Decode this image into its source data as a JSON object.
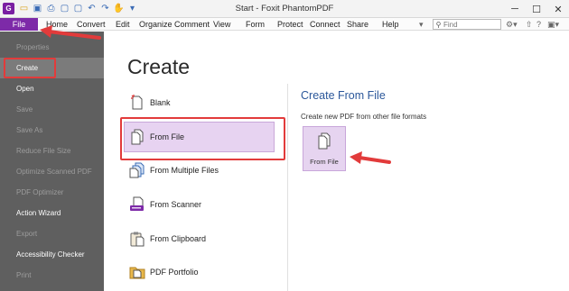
{
  "window": {
    "title": "Start - Foxit PhantomPDF"
  },
  "app_logo": "G",
  "quick_access": [
    {
      "icon": "open-folder-icon",
      "glyph": "▭",
      "tone": "yellow"
    },
    {
      "icon": "save-icon",
      "glyph": "▣",
      "tone": "blue"
    },
    {
      "icon": "print-icon",
      "glyph": "⎙",
      "tone": "blue"
    },
    {
      "icon": "page-icon",
      "glyph": "▢",
      "tone": "blue"
    },
    {
      "icon": "page-icon",
      "glyph": "▢",
      "tone": "blue"
    },
    {
      "icon": "undo-icon",
      "glyph": "↶",
      "tone": "blue"
    },
    {
      "icon": "redo-icon",
      "glyph": "↷",
      "tone": "blue"
    },
    {
      "icon": "hand-tool-icon",
      "glyph": "✋",
      "tone": "blue"
    },
    {
      "icon": "customize-icon",
      "glyph": "▾",
      "tone": "blue"
    }
  ],
  "menu": {
    "file": "File",
    "items": [
      "Home",
      "Convert",
      "Edit",
      "Organize",
      "Comment",
      "View",
      "Form",
      "Protect",
      "Connect",
      "Share",
      "Help"
    ]
  },
  "search": {
    "placeholder": "Find"
  },
  "window_controls": {
    "minimize": "─",
    "maximize": "☐",
    "close": "✕"
  },
  "sidebar": {
    "items": [
      {
        "label": "Properties",
        "state": "disabled"
      },
      {
        "label": "Create",
        "state": "selected"
      },
      {
        "label": "Open",
        "state": "enabled"
      },
      {
        "label": "Save",
        "state": "disabled"
      },
      {
        "label": "Save As",
        "state": "disabled"
      },
      {
        "label": "Reduce File Size",
        "state": "disabled"
      },
      {
        "label": "Optimize Scanned PDF",
        "state": "disabled"
      },
      {
        "label": "PDF Optimizer",
        "state": "disabled"
      },
      {
        "label": "Action Wizard",
        "state": "enabled"
      },
      {
        "label": "Export",
        "state": "disabled"
      },
      {
        "label": "Accessibility Checker",
        "state": "enabled"
      },
      {
        "label": "Print",
        "state": "disabled"
      }
    ]
  },
  "main": {
    "title": "Create",
    "options": [
      {
        "label": "Blank",
        "icon": "blank-page-icon",
        "selected": false
      },
      {
        "label": "From File",
        "icon": "from-file-icon",
        "selected": true
      },
      {
        "label": "From Multiple Files",
        "icon": "multiple-files-icon",
        "selected": false
      },
      {
        "label": "From Scanner",
        "icon": "scanner-icon",
        "selected": false
      },
      {
        "label": "From Clipboard",
        "icon": "clipboard-icon",
        "selected": false
      },
      {
        "label": "PDF Portfolio",
        "icon": "portfolio-icon",
        "selected": false
      }
    ],
    "pane": {
      "title": "Create From File",
      "description": "Create new PDF from other file formats",
      "tile_label": "From File"
    }
  },
  "colors": {
    "accent": "#7d2aa8",
    "sidebar": "#5f5f5f",
    "highlight": "#e7d3f1",
    "annotation": "#e23b3b",
    "pane_title": "#2b579a"
  }
}
